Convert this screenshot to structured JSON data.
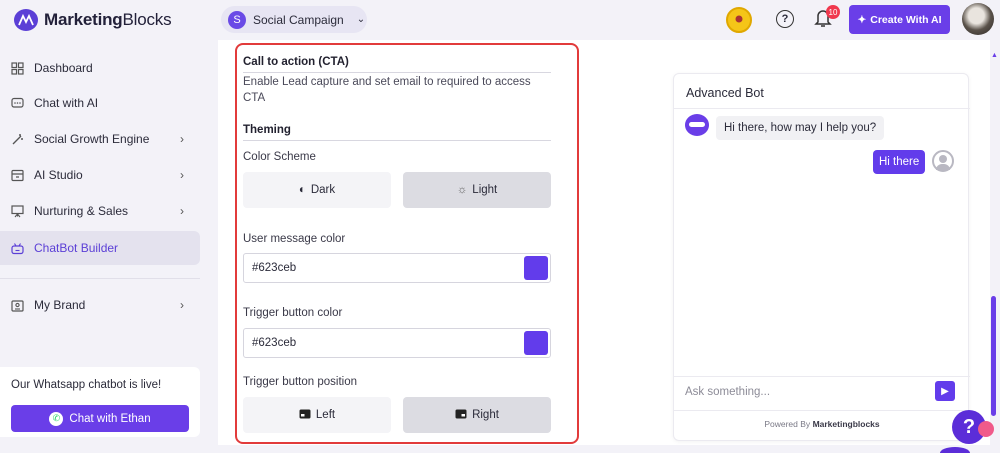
{
  "brand": {
    "name_bold": "Marketing",
    "name_rest": "Blocks"
  },
  "header": {
    "campaign_initial": "S",
    "campaign_name": "Social Campaign",
    "notification_count": "10",
    "create_button": "Create With AI"
  },
  "sidebar": {
    "items": [
      {
        "label": "Dashboard",
        "icon": "grid-icon"
      },
      {
        "label": "Chat with AI",
        "icon": "chat-icon"
      },
      {
        "label": "Social Growth Engine",
        "icon": "magic-wand-icon"
      },
      {
        "label": "AI Studio",
        "icon": "inbox-icon"
      },
      {
        "label": "Nurturing & Sales",
        "icon": "presentation-icon"
      },
      {
        "label": "ChatBot Builder",
        "icon": "bot-icon"
      },
      {
        "label": "My Brand",
        "icon": "id-card-icon"
      }
    ],
    "whatsapp_card": {
      "text": "Our Whatsapp chatbot is live!",
      "button": "Chat with Ethan"
    }
  },
  "settings": {
    "cta_title": "Call to action (CTA)",
    "cta_description": "Enable Lead capture and set email to required to access CTA",
    "theming_title": "Theming",
    "color_scheme_label": "Color Scheme",
    "scheme_options": [
      "Dark",
      "Light"
    ],
    "selected_scheme": "Light",
    "user_message_color_label": "User message color",
    "user_message_color": "#623ceb",
    "trigger_button_color_label": "Trigger button color",
    "trigger_button_color": "#623ceb",
    "trigger_position_label": "Trigger button position",
    "position_options": [
      "Left",
      "Right"
    ],
    "selected_position": "Right"
  },
  "preview": {
    "title": "Advanced Bot",
    "bot_message": "Hi there, how may I help you?",
    "user_message": "Hi there",
    "input_placeholder": "Ask something...",
    "powered_prefix": "Powered By",
    "powered_brand": "Marketingblocks"
  },
  "colors": {
    "accent": "#6a3ee8",
    "highlight_border": "#e23b3b"
  }
}
